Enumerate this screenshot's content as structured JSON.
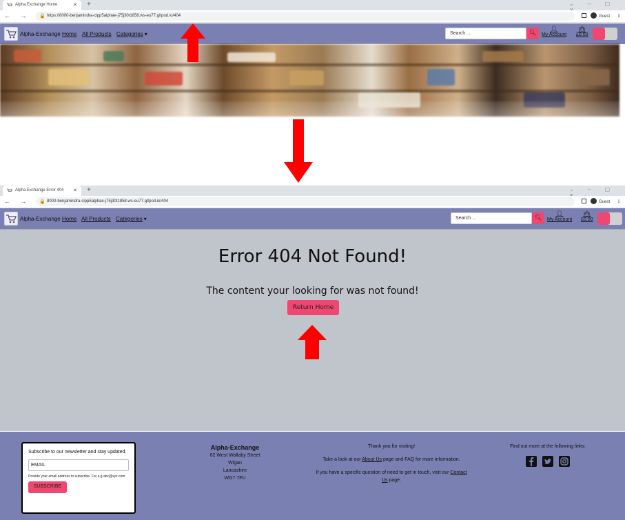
{
  "shot1": {
    "browser": {
      "tab_title": "Alpha Exchange Home",
      "url": "https://8000-benjamindra-cipp5alphae-j75j30t1858.ws-eu77.gitpod.io/404",
      "profile": "Guest"
    },
    "nav": {
      "brand": "Alpha-Exchange",
      "home": "Home",
      "all_products": "All Products",
      "categories": "Categories",
      "search_placeholder": "Search ...",
      "my_account": "My Account",
      "cart_total": "£0.00"
    }
  },
  "shot2": {
    "browser": {
      "tab_title": "Alpha Exchange Error 404",
      "url": "8000-benjamindra-cipp5alphae-j75j30t1858.ws-eu77.gitpod.io/404",
      "profile": "Guest"
    },
    "nav": {
      "brand": "Alpha-Exchange",
      "home": "Home",
      "all_products": "All Products",
      "categories": "Categories",
      "search_placeholder": "Search ...",
      "my_account": "My Account",
      "cart_total": "£0.00"
    },
    "error": {
      "title": "Error 404 Not Found!",
      "message": "The content your looking for was not found!",
      "button": "Return Home"
    },
    "footer": {
      "newsletter": {
        "text": "Subscribe to our newsletter and stay updated.",
        "email_placeholder": "EMAIL",
        "hint": "Provide your email address to subscribe. For e.g abc@xyz.com",
        "button": "SUBSCRIBE"
      },
      "address": {
        "name": "Alpha-Exchange",
        "line1": "62 West Wallaby Street",
        "line2": "Wigan",
        "line3": "Lancashire",
        "line4": "WG7 7FU"
      },
      "thanks": {
        "line1": "Thank you for visiting!",
        "line2_pre": "Take a look at our",
        "line2_link": "About Us",
        "line2_post": "page and FAQ for more information.",
        "line3_pre": "If you have a specific question of need to get in touch, visit our",
        "line3_link": "Contact Us",
        "line3_post": "page."
      },
      "links": {
        "heading": "Find out more at the following links:",
        "icons": [
          "facebook-icon",
          "twitter-icon",
          "instagram-icon"
        ]
      }
    }
  },
  "colors": {
    "nav_bg": "#7a80b2",
    "accent": "#ef476f",
    "page_bg": "#c0c4cb",
    "annotation_arrow": "#ff0000"
  }
}
